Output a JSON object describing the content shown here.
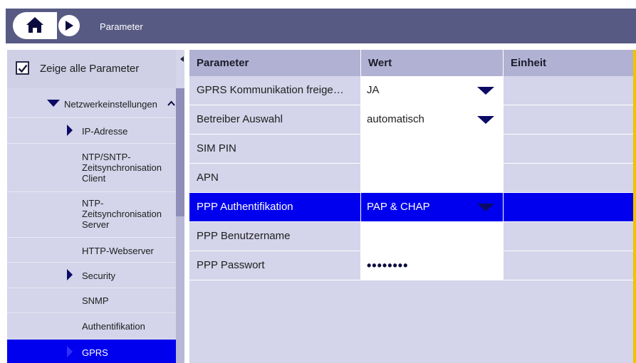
{
  "header": {
    "breadcrumb": "Parameter",
    "home_icon": "home-icon",
    "next_icon": "play-right-icon"
  },
  "sidebar": {
    "show_all_label": "Zeige alle Parameter",
    "show_all_checked": true,
    "items": [
      {
        "label": "Netzwerkeinstellungen",
        "icon": "triangle-down-icon"
      },
      {
        "label": "IP-Adresse",
        "icon": "triangle-right-icon"
      },
      {
        "label": "NTP/SNTP-\nZeitsynchronisation\nClient"
      },
      {
        "label": "NTP-\nZeitsynchronisation\nServer"
      },
      {
        "label": "HTTP-Webserver"
      },
      {
        "label": "Security",
        "icon": "triangle-right-icon"
      },
      {
        "label": "SNMP"
      },
      {
        "label": "Authentifikation"
      },
      {
        "label": "GPRS",
        "icon": "triangle-right-icon",
        "selected": true
      }
    ]
  },
  "table": {
    "headers": [
      "Parameter",
      "Wert",
      "Einheit"
    ],
    "rows": [
      {
        "param": "GPRS Kommunikation freige…",
        "value": "JA",
        "dropdown": true,
        "unit": ""
      },
      {
        "param": "Betreiber Auswahl",
        "value": "automatisch",
        "dropdown": true,
        "unit": ""
      },
      {
        "param": "SIM PIN",
        "value": "",
        "dropdown": false,
        "unit": ""
      },
      {
        "param": "APN",
        "value": "",
        "dropdown": false,
        "unit": ""
      },
      {
        "param": "PPP Authentifikation",
        "value": "PAP & CHAP",
        "dropdown": true,
        "unit": "",
        "selected": true
      },
      {
        "param": "PPP Benutzername",
        "value": "",
        "dropdown": false,
        "unit": ""
      },
      {
        "param": "PPP Passwort",
        "value": "••••••••",
        "dropdown": false,
        "unit": "",
        "masked": true
      }
    ]
  },
  "colors": {
    "titlebar": "#575a83",
    "panel": "#d4d4ea",
    "header_row": "#b1b1d3",
    "selection": "#0000ee",
    "accent": "#f2c200",
    "icon": "#0b0b66"
  }
}
